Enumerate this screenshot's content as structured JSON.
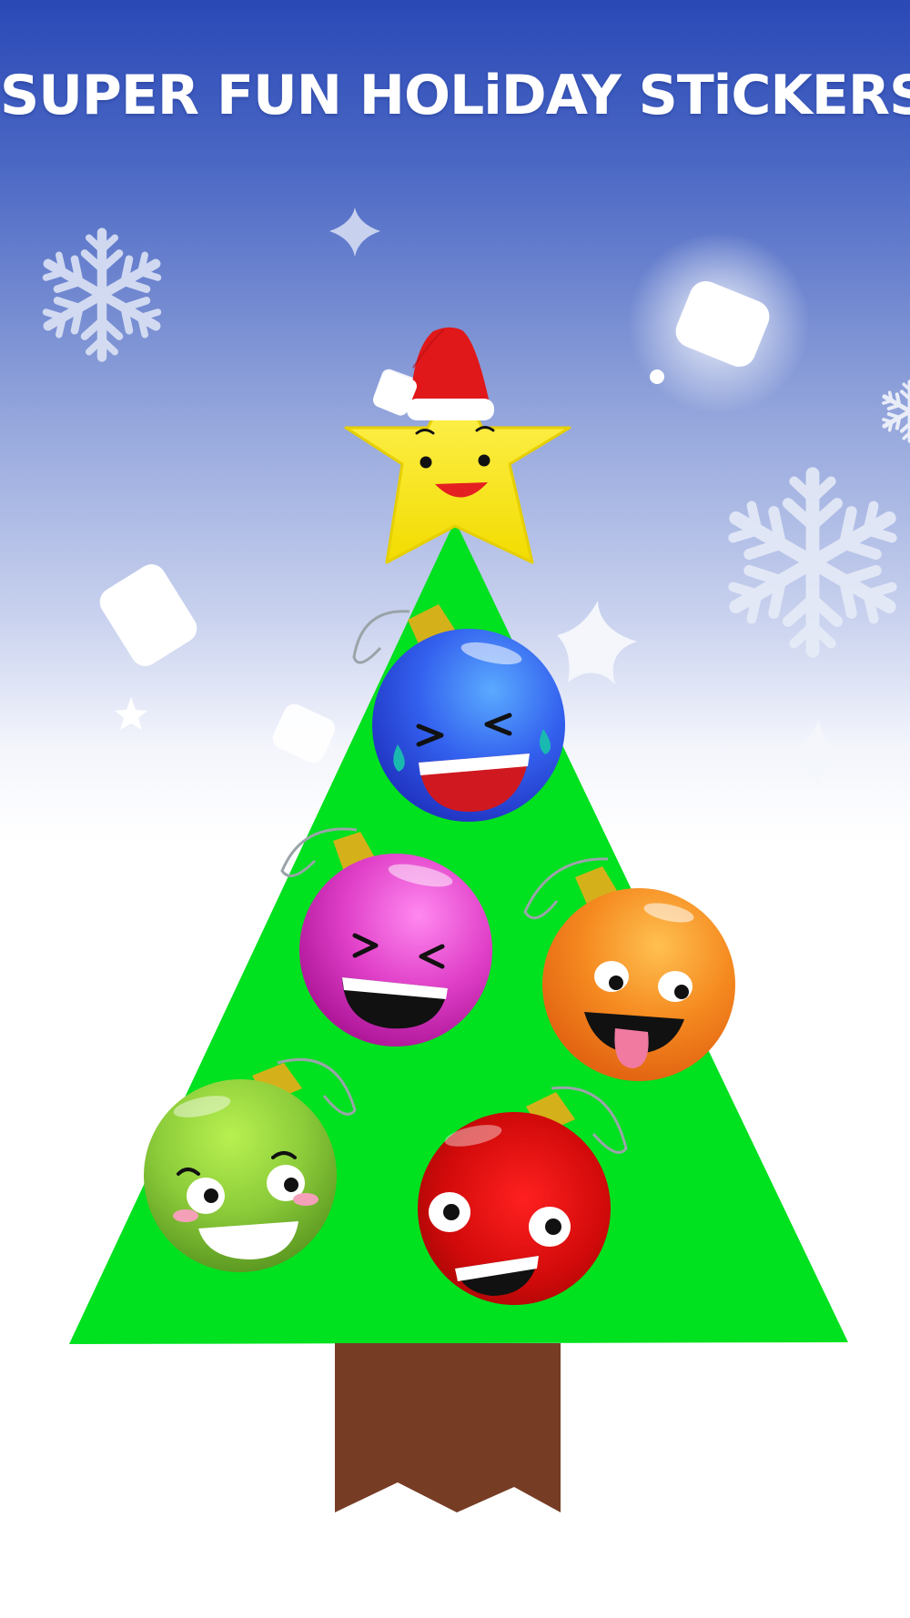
{
  "title": "SUPER FUN HOLiDAY STiCKERS!",
  "colors": {
    "sky_top": "#2a49b6",
    "sky_mid": "#aab8e4",
    "snow": "#ffffff",
    "tree": "#00e11f",
    "trunk": "#763c24",
    "star": "#ffee1a",
    "santa_hat": "#e0181a",
    "ornament_cap": "#d4b11a"
  },
  "stickers": [
    {
      "name": "star-sticker",
      "expression": "smiling with santa hat",
      "color": "#ffee1a"
    },
    {
      "name": "blue-ornament-sticker",
      "expression": "laughing with tears",
      "color": "#3355ee"
    },
    {
      "name": "pink-ornament-sticker",
      "expression": "laughing squint",
      "color": "#e040c8"
    },
    {
      "name": "orange-ornament-sticker",
      "expression": "tongue out",
      "color": "#f58a20"
    },
    {
      "name": "green-ornament-sticker",
      "expression": "happy blushing",
      "color": "#8ccc3a"
    },
    {
      "name": "red-ornament-sticker",
      "expression": "big grin",
      "color": "#dd0a0a"
    }
  ],
  "decorations": [
    "snowflake-icon",
    "sparkle-icon",
    "snowflake-icon",
    "sparkle-icon"
  ]
}
